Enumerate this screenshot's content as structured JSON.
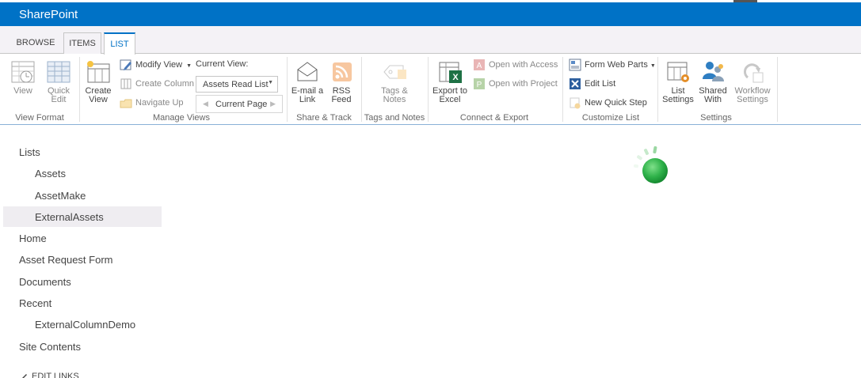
{
  "app": {
    "title": "SharePoint"
  },
  "tabs": [
    {
      "label": "BROWSE"
    },
    {
      "label": "ITEMS"
    },
    {
      "label": "LIST"
    }
  ],
  "ribbon": {
    "view_format": {
      "label": "View Format",
      "view": "View",
      "quick_edit": "Quick\nEdit"
    },
    "manage_views": {
      "label": "Manage Views",
      "create_view": "Create\nView",
      "modify_view": "Modify View",
      "create_column": "Create Column",
      "navigate_up": "Navigate Up",
      "current_view_label": "Current View:",
      "current_view_value": "Assets Read List",
      "current_page": "Current Page"
    },
    "share_track": {
      "label": "Share & Track",
      "email": "E-mail a\nLink",
      "rss": "RSS\nFeed"
    },
    "tags_notes": {
      "label": "Tags and Notes",
      "tags": "Tags &\nNotes"
    },
    "connect_export": {
      "label": "Connect & Export",
      "export_excel": "Export to\nExcel",
      "open_access": "Open with Access",
      "open_project": "Open with Project"
    },
    "customize_list": {
      "label": "Customize List",
      "form_web_parts": "Form Web Parts",
      "edit_list": "Edit List",
      "new_quick_step": "New Quick Step"
    },
    "settings": {
      "label": "Settings",
      "list_settings": "List\nSettings",
      "shared_with": "Shared\nWith",
      "workflow_settings": "Workflow\nSettings"
    }
  },
  "nav": {
    "lists": "Lists",
    "assets": "Assets",
    "assetmake": "AssetMake",
    "externalassets": "ExternalAssets",
    "home": "Home",
    "asset_request_form": "Asset Request Form",
    "documents": "Documents",
    "recent": "Recent",
    "externalcolumndemo": "ExternalColumnDemo",
    "site_contents": "Site Contents",
    "edit_links": "EDIT LINKS"
  },
  "colors": {
    "brand": "#0072c6",
    "spinner": "#3cb54a"
  }
}
